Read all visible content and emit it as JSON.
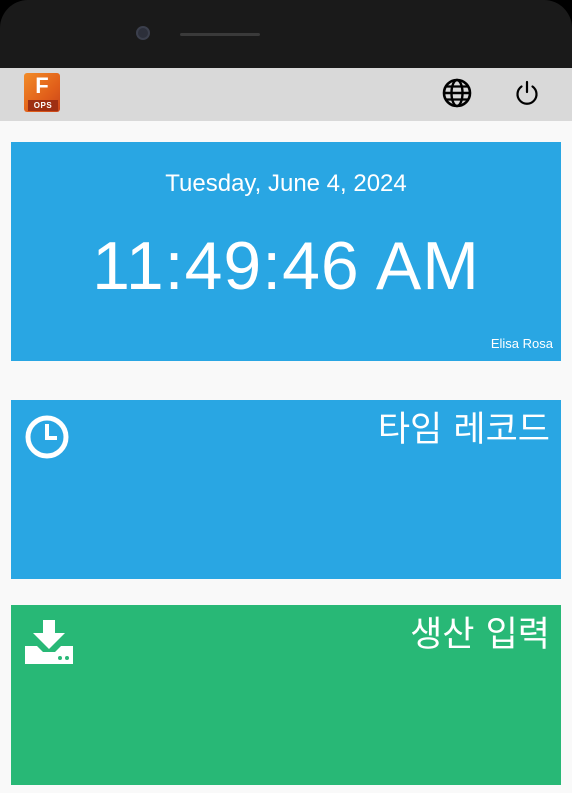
{
  "app": {
    "logo_letter": "F",
    "logo_badge": "OPS"
  },
  "header": {
    "icons": [
      "globe-icon",
      "power-icon"
    ]
  },
  "clock": {
    "date": "Tuesday, June 4, 2024",
    "time": "11:49:46 AM",
    "user": "Elisa Rosa"
  },
  "tiles": [
    {
      "label": "타임 레코드",
      "icon": "clock-icon",
      "color": "#29a6e3"
    },
    {
      "label": "생산 입력",
      "icon": "download-icon",
      "color": "#28b876"
    }
  ]
}
